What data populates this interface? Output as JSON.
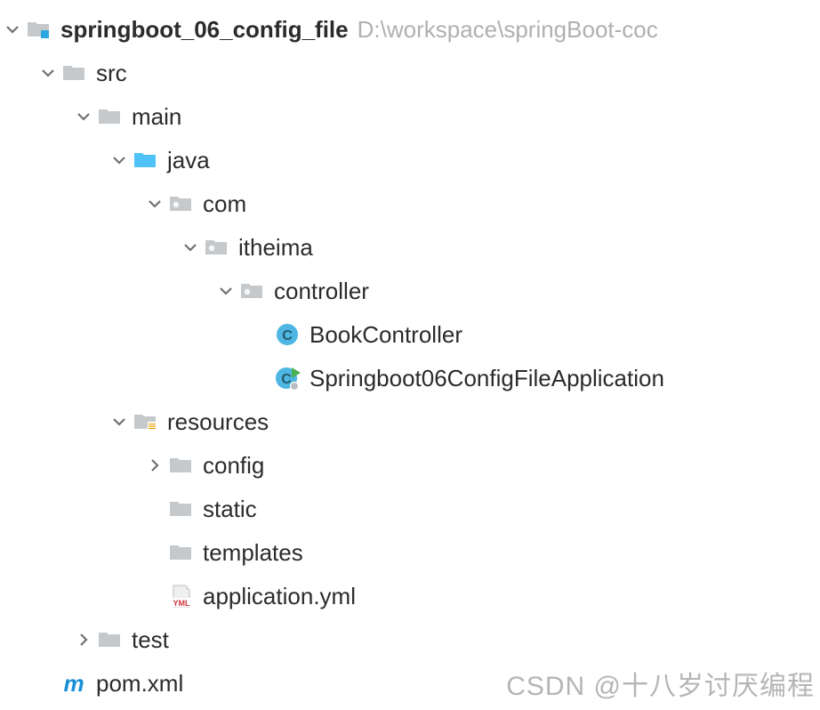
{
  "root": {
    "name": "springboot_06_config_file",
    "path_hint": "D:\\workspace\\springBoot-coc"
  },
  "nodes": {
    "src": "src",
    "main": "main",
    "java": "java",
    "com": "com",
    "itheima": "itheima",
    "controller": "controller",
    "book_controller": "BookController",
    "app_class": "Springboot06ConfigFileApplication",
    "resources": "resources",
    "config": "config",
    "static": "static",
    "templates": "templates",
    "app_yml": "application.yml",
    "test": "test",
    "pom": "pom.xml"
  },
  "watermark": "CSDN @十八岁讨厌编程"
}
